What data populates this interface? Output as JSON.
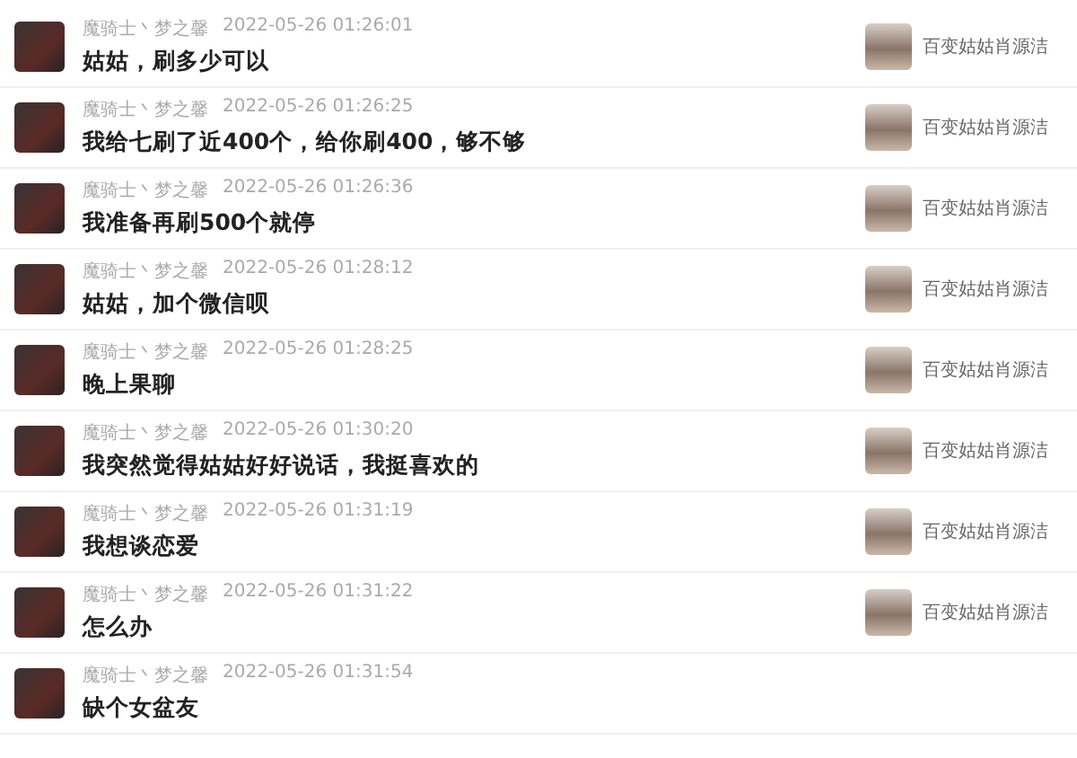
{
  "messages": [
    {
      "sender": "魔骑士丶梦之馨",
      "time": "2022-05-26 01:26:01",
      "text": "姑姑，刷多少可以",
      "target": "百变姑姑肖源洁"
    },
    {
      "sender": "魔骑士丶梦之馨",
      "time": "2022-05-26 01:26:25",
      "text": "我给七刷了近400个，给你刷400，够不够",
      "target": "百变姑姑肖源洁"
    },
    {
      "sender": "魔骑士丶梦之馨",
      "time": "2022-05-26 01:26:36",
      "text": "我准备再刷500个就停",
      "target": "百变姑姑肖源洁"
    },
    {
      "sender": "魔骑士丶梦之馨",
      "time": "2022-05-26 01:28:12",
      "text": "姑姑，加个微信呗",
      "target": "百变姑姑肖源洁"
    },
    {
      "sender": "魔骑士丶梦之馨",
      "time": "2022-05-26 01:28:25",
      "text": "晚上果聊",
      "target": "百变姑姑肖源洁"
    },
    {
      "sender": "魔骑士丶梦之馨",
      "time": "2022-05-26 01:30:20",
      "text": "我突然觉得姑姑好好说话，我挺喜欢的",
      "target": "百变姑姑肖源洁"
    },
    {
      "sender": "魔骑士丶梦之馨",
      "time": "2022-05-26 01:31:19",
      "text": "我想谈恋爱",
      "target": "百变姑姑肖源洁"
    },
    {
      "sender": "魔骑士丶梦之馨",
      "time": "2022-05-26 01:31:22",
      "text": "怎么办",
      "target": "百变姑姑肖源洁"
    },
    {
      "sender": "魔骑士丶梦之馨",
      "time": "2022-05-26 01:31:54",
      "text": "缺个女盆友"
    }
  ]
}
